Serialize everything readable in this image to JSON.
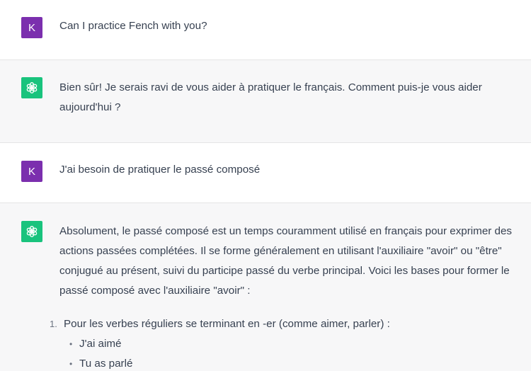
{
  "messages": [
    {
      "role": "user",
      "avatar_letter": "K",
      "text": "Can I practice Fench with you?"
    },
    {
      "role": "assistant",
      "avatar_icon": "openai-logo-icon",
      "text": "Bien sûr! Je serais ravi de vous aider à pratiquer le français. Comment puis-je vous aider aujourd'hui ?"
    },
    {
      "role": "user",
      "avatar_letter": "K",
      "text": "J'ai besoin de pratiquer le passé composé"
    },
    {
      "role": "assistant",
      "avatar_icon": "openai-logo-icon",
      "text": "Absolument, le passé composé est un temps couramment utilisé en français pour exprimer des actions passées complétées. Il se forme généralement en utilisant l'auxiliaire \"avoir\" ou \"être\" conjugué au présent, suivi du participe passé du verbe principal. Voici les bases pour former le passé composé avec l'auxiliaire \"avoir\" :"
    }
  ],
  "list": {
    "item1_number": "1.",
    "item1_text": "Pour les verbes réguliers se terminant en -er (comme aimer, parler) :",
    "bullet_glyph": "•",
    "sub_items": [
      "J'ai aimé",
      "Tu as parlé"
    ]
  },
  "colors": {
    "user_avatar": "#7b2fae",
    "bot_avatar": "#19c37d",
    "assistant_bg": "#f7f7f8"
  }
}
